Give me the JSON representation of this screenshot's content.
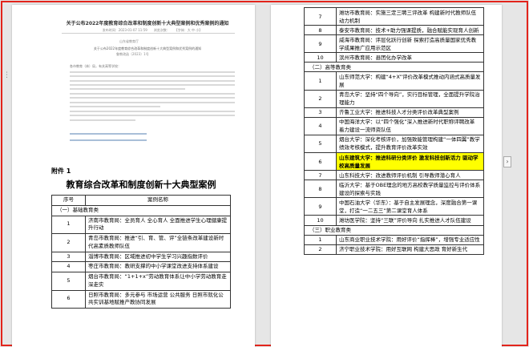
{
  "notice": {
    "title": "关于公布2022年度教育综合改革和制度创新十大典型案例和优秀案例的通知",
    "meta": "发布时间：2023-01-07 11:59　　浏览次数：　　【字体：大 中 小】",
    "source": "山东省教育厅",
    "subtitle": "关于公布2022年度教育综合改革和制度创新十大典型案例和优秀案例的通知",
    "doc_no": "鲁教改函〔2023〕1号",
    "greeting": "各市教育（体）局，有关高等学校："
  },
  "annex": {
    "label": "附件 1",
    "title": "教育综合改革和制度创新十大典型案例"
  },
  "left_table": {
    "headers": [
      "序号",
      "案例名称"
    ],
    "section_basic": "（一）基础教育类",
    "rows": [
      {
        "no": "1",
        "name": "济南市教育局：全员育人 全心育人 全面推进学生心理健康提升行动"
      },
      {
        "no": "2",
        "name": "青岛市教育局：推进“引、育、管、评”全链条改革建设新时代高素质教师队伍"
      },
      {
        "no": "3",
        "name": "淄博市教育局：区域推进初中学生学习兴趣指数评价"
      },
      {
        "no": "4",
        "name": "枣庄市教育局：教研支撑的中小学课堂改进支持体系建设"
      },
      {
        "no": "5",
        "name": "烟台市教育局：“1+1+x”劳动教育体系让中小学劳动教育走深走实"
      },
      {
        "no": "6",
        "name": "日照市教育局：多元参与 市场运营 公共服务 日照市就化公共实训基地赋推产教协同发展"
      }
    ]
  },
  "right_table": {
    "rows_basic": [
      {
        "no": "7",
        "name": "潍坊市教育局：实施三定三聘三评改革 构建新时代教师队伍动力机制"
      },
      {
        "no": "8",
        "name": "泰安市教育局：技术+助力强课提质，融合赋能实现育人创新"
      },
      {
        "no": "9",
        "name": "威海市教育局：评层化跃行创新 探索打造高质量国家优秀教学成果推广应用示范区"
      },
      {
        "no": "10",
        "name": "滨州市教育局：县团化办学改革"
      }
    ],
    "section_higher": "（二）高等教育类",
    "rows_higher": [
      {
        "no": "1",
        "name": "山东师范大学：构建“4+X”评价改革模式推动内涵式高质量发展",
        "highlight": false
      },
      {
        "no": "2",
        "name": "青岛大学：坚持“四个导向”，实行目标管理，全面提升学院治理能力",
        "highlight": false
      },
      {
        "no": "3",
        "name": "齐鲁工业大学：推进科技人才分类评价改革典型案例",
        "highlight": false
      },
      {
        "no": "4",
        "name": "中国海洋大学：以“四个强化”深入推进新时代职称评聘改革 着力建设一流师资队伍",
        "highlight": false
      },
      {
        "no": "5",
        "name": "烟台大学：深化考核评价，加强致能管理构建“一体四翼”教学绩效考核模式，提升教育评价改革实效",
        "highlight": false
      },
      {
        "no": "6",
        "name": "山东建筑大学：推进科研分类评价 激发科技创新活力 驱动学校高质量发展",
        "highlight": true
      },
      {
        "no": "7",
        "name": "山东科技大学：改进教师评价机制 引导教师潜心育人",
        "highlight": false
      },
      {
        "no": "8",
        "name": "临沂大学：基于OBE理念的地方高校教学质量监控与评价体系建设的探索与实践",
        "highlight": false
      },
      {
        "no": "9",
        "name": "中国石油大学（华东）：基于自主发展理念，深度融合第一课堂，打造“一二五三”第二课堂育人体系",
        "highlight": false
      },
      {
        "no": "10",
        "name": "潍坊医学院：坚持“三联”评价导向 扎实推进人才队伍建设",
        "highlight": false
      }
    ],
    "section_vocational": "（三）职业教育类",
    "rows_vocational": [
      {
        "no": "1",
        "name": "山东商业职业技术学院：用好评价“指挥棒”，增强专业适应性"
      },
      {
        "no": "2",
        "name": "济宁职业技术学院：用好互联网 构建大思政 育好新生代"
      }
    ]
  },
  "colors": {
    "frame_border": "#e2241b",
    "highlight": "#ffff00",
    "background": "#e6e6e6"
  }
}
